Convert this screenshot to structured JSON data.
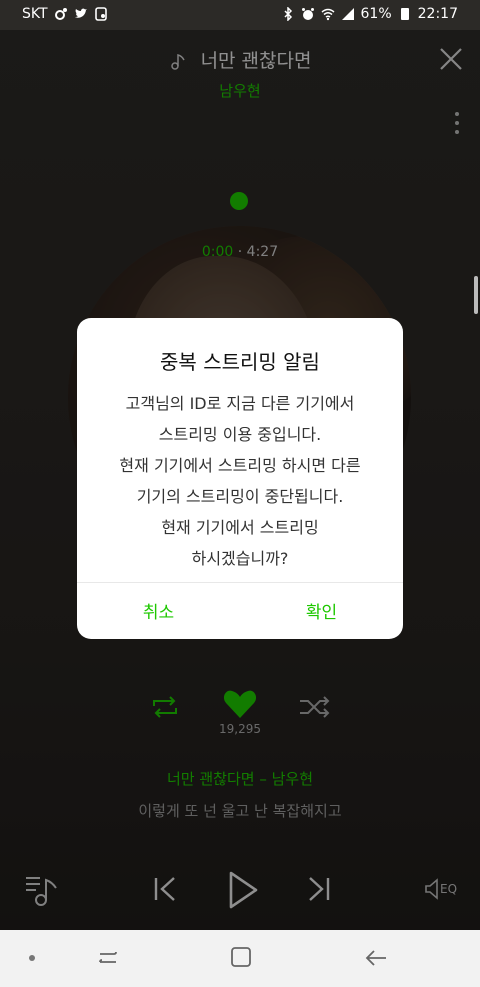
{
  "status_bar": {
    "carrier": "SKT",
    "battery": "61%",
    "time": "22:17"
  },
  "player": {
    "song_title": "너만 괜찮다면",
    "artist": "남우현",
    "time_current": "0:00",
    "time_separator": "·",
    "time_total": "4:27",
    "like_count": "19,295",
    "now_playing": "너만 괜찮다면 – 남우현",
    "lyric": "이렇게 또 넌 울고 난 복잡해지고",
    "eq_label": "EQ"
  },
  "dialog": {
    "title": "중복 스트리밍 알림",
    "lines": [
      "고객님의 ID로 지금 다른 기기에서",
      "스트리밍 이용 중입니다.",
      "현재 기기에서 스트리밍 하시면 다른",
      "기기의 스트리밍이 중단됩니다.",
      "현재 기기에서 스트리밍",
      "하시겠습니까?"
    ],
    "cancel_label": "취소",
    "confirm_label": "확인"
  },
  "colors": {
    "accent": "#1ec800",
    "dialog_bg": "#ffffff",
    "nav_bg": "#f2f2f2"
  },
  "icons": [
    "music-note-icon",
    "close-icon",
    "more-vert-icon",
    "repeat-icon",
    "heart-icon",
    "shuffle-icon",
    "playlist-icon",
    "previous-icon",
    "play-icon",
    "next-icon",
    "eq-icon"
  ]
}
